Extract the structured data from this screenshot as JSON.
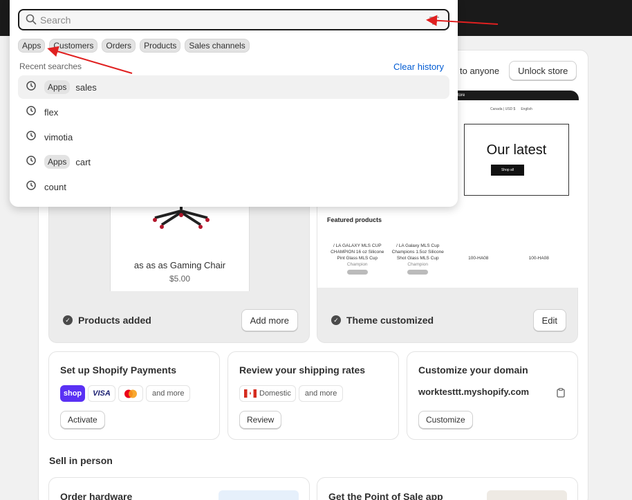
{
  "search": {
    "placeholder": "Search"
  },
  "filters": [
    "Apps",
    "Customers",
    "Orders",
    "Products",
    "Sales channels"
  ],
  "recent": {
    "label": "Recent searches",
    "clear": "Clear history",
    "items": [
      {
        "tag": "Apps",
        "query": "sales"
      },
      {
        "tag": "",
        "query": "flex"
      },
      {
        "tag": "",
        "query": "vimotia"
      },
      {
        "tag": "Apps",
        "query": "cart"
      },
      {
        "tag": "",
        "query": "count"
      }
    ]
  },
  "store": {
    "text": "to anyone",
    "unlock_label": "Unlock store"
  },
  "product_card": {
    "name": "as as as Gaming Chair",
    "price": "$5.00",
    "status": "Products added",
    "button": "Add more"
  },
  "theme_card": {
    "bar_text": "store",
    "nav": [
      "Canada | USD $",
      "English"
    ],
    "hero_title": "Our latest",
    "hero_button": "Shop all",
    "featured_title": "Featured products",
    "products": [
      {
        "title": "/ LA GALAXY MLS CUP CHAMPION 16 oz Silicone Pint Glass MLS Cup",
        "sub": "Champion",
        "pill": "Sold out"
      },
      {
        "title": "/ LA Galaxy MLS Cup Champions 1.5oz Silicone Shot Glass MLS Cup",
        "sub": "Champion",
        "pill": "Sold out"
      },
      {
        "title": "100-HA08",
        "sub": "",
        "pill": ""
      },
      {
        "title": "100-HA08",
        "sub": "",
        "pill": ""
      }
    ],
    "status": "Theme customized",
    "button": "Edit"
  },
  "payments": {
    "title": "Set up Shopify Payments",
    "chips": [
      "shop",
      "VISA",
      "mastercard",
      "and more"
    ],
    "button": "Activate"
  },
  "shipping": {
    "title": "Review your shipping rates",
    "chips": [
      "Domestic",
      "and more"
    ],
    "button": "Review"
  },
  "domain": {
    "title": "Customize your domain",
    "value": "worktesttt.myshopify.com",
    "button": "Customize"
  },
  "sell": {
    "title": "Sell in person",
    "cards": [
      "Order hardware",
      "Get the Point of Sale app"
    ]
  },
  "colors": {
    "accent": "#005bd3",
    "shop_purple": "#5a31f4",
    "annotation": "#e02020"
  }
}
